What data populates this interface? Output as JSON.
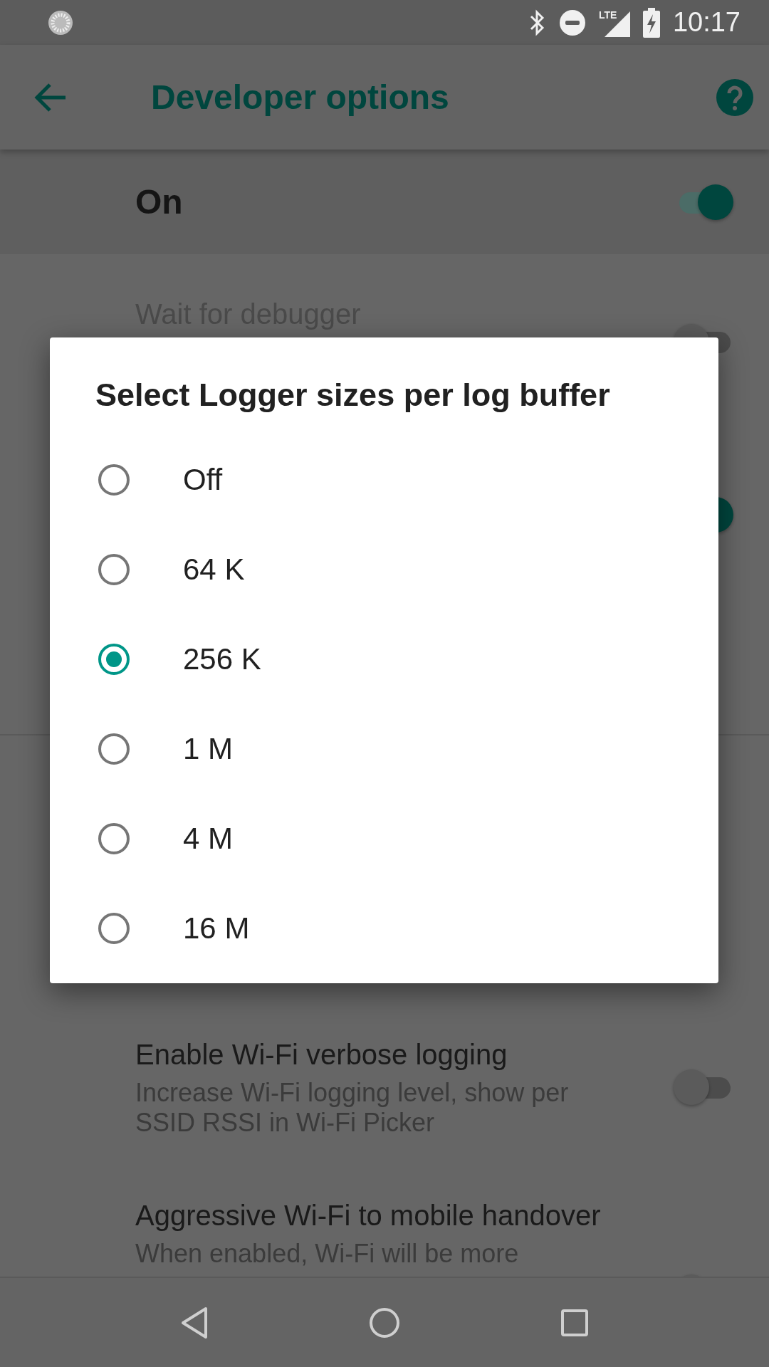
{
  "status_bar": {
    "network": "LTE",
    "time": "10:17"
  },
  "app_bar": {
    "title": "Developer options"
  },
  "master_switch": {
    "label": "On",
    "on": true
  },
  "settings": [
    {
      "title": "Wait for debugger",
      "disabled": true,
      "on": false
    },
    {
      "on": true
    },
    {
      "title": "Enable Wi-Fi verbose logging",
      "disabled": false,
      "summary": "Increase Wi-Fi logging level, show per SSID RSSI in Wi-Fi Picker",
      "on": false
    },
    {
      "title": "Aggressive Wi-Fi to mobile handover",
      "disabled": false,
      "summary": "When enabled, Wi-Fi will be more",
      "on": false
    }
  ],
  "dialog": {
    "title": "Select Logger sizes per log buffer",
    "options": [
      {
        "label": "Off",
        "selected": false
      },
      {
        "label": "64 K",
        "selected": false
      },
      {
        "label": "256 K",
        "selected": true
      },
      {
        "label": "1 M",
        "selected": false
      },
      {
        "label": "4 M",
        "selected": false
      },
      {
        "label": "16 M",
        "selected": false
      }
    ]
  }
}
